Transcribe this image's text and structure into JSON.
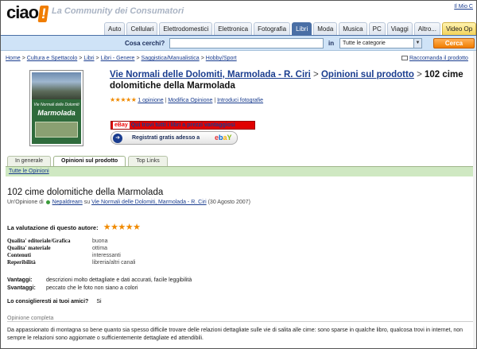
{
  "header": {
    "logo_text": "ciao",
    "logo_bang": "!",
    "tagline": "La Community dei Consumatori",
    "mio": "Il Mio C"
  },
  "nav_tabs": [
    {
      "label": "Auto"
    },
    {
      "label": "Cellulari"
    },
    {
      "label": "Elettrodomestici"
    },
    {
      "label": "Elettronica"
    },
    {
      "label": "Fotografia"
    },
    {
      "label": "Libri",
      "active": true
    },
    {
      "label": "Moda"
    },
    {
      "label": "Musica"
    },
    {
      "label": "PC"
    },
    {
      "label": "Viaggi"
    },
    {
      "label": "Altro..."
    },
    {
      "label": "Video Op"
    }
  ],
  "search": {
    "label": "Cosa cerchi?",
    "value": "",
    "in_label": "in",
    "category": "Tutte le categorie",
    "button": "Cerca"
  },
  "breadcrumb": {
    "items": [
      "Home",
      "Cultura e Spettacolo",
      "Libri",
      "Libri - Genere",
      "Saggistica/Manualistica",
      "Hobby/Sport"
    ],
    "separator": ">",
    "recommend": "Raccomanda il prodotto"
  },
  "product": {
    "cover": {
      "line1": "Vie Normali delle Dolomiti",
      "line2": "Marmolada"
    },
    "title_link": "Vie Normali delle Dolomiti, Marmolada - R. Ciri",
    "sep1": ">",
    "opinions_link": "Opinioni sul prodotto",
    "sep2": ">",
    "opinion_title": "102 cime dolomitiche della Marmolada",
    "stars": "★★★★★",
    "opinion_count": "1 opinione",
    "edit_opinion": "Modifica Opinione",
    "add_photos": "Introduci fotografie"
  },
  "ebay": {
    "banner_text": "Qui trovi tutti i libri a prezzi vantaggiosi",
    "register_text": "Registrati gratis adesso a"
  },
  "content_tabs": [
    {
      "label": "In generale"
    },
    {
      "label": "Opinioni sul prodotto",
      "active": true
    },
    {
      "label": "Top Links"
    }
  ],
  "subbar_link": "Tutte le Opinioni",
  "opinion": {
    "title": "102 cime dolomitiche della Marmolada",
    "by_prefix": "Un'Opinione di",
    "author": "Nepaldream",
    "on": "su",
    "product_link": "Vie Normali delle Dolomiti, Marmolada - R. Ciri",
    "date": "(30 Agosto 2007)",
    "valuation_label": "La valutazione di questo autore:",
    "valuation_stars": "★★★★★",
    "ratings": [
      {
        "key": "Qualita' editoriale/Grafica",
        "value": "buona"
      },
      {
        "key": "Qualita' materiale",
        "value": "ottima"
      },
      {
        "key": "Contenuti",
        "value": "interessanti"
      },
      {
        "key": "Reperibilità",
        "value": "libreria/altri canali"
      }
    ],
    "vantaggi_label": "Vantaggi:",
    "vantaggi": "descrizioni molto dettagliate e dati accurati, facile leggibilità",
    "svantaggi_label": "Svantaggi:",
    "svantaggi": "peccato che le foto non siano a colori",
    "consiglio_q": "Lo consiglieresti ai tuoi amici?",
    "consiglio_a": "Si",
    "full_label": "Opinione completa",
    "full_text": "Da appassionato di montagna so bene quanto sia spesso difficile trovare delle relazioni dettagliate sulle vie di salita alle cime: sono sparse in qualche libro, qualcosa trovi in internet, non sempre le relazioni sono aggiornate o sufficientemente dettagliate ed attendibili."
  },
  "colors": {
    "accent": "#f07d00",
    "nav_active": "#4a6fa5",
    "link": "#1a3d8f",
    "subbar": "#cfe8c2"
  }
}
